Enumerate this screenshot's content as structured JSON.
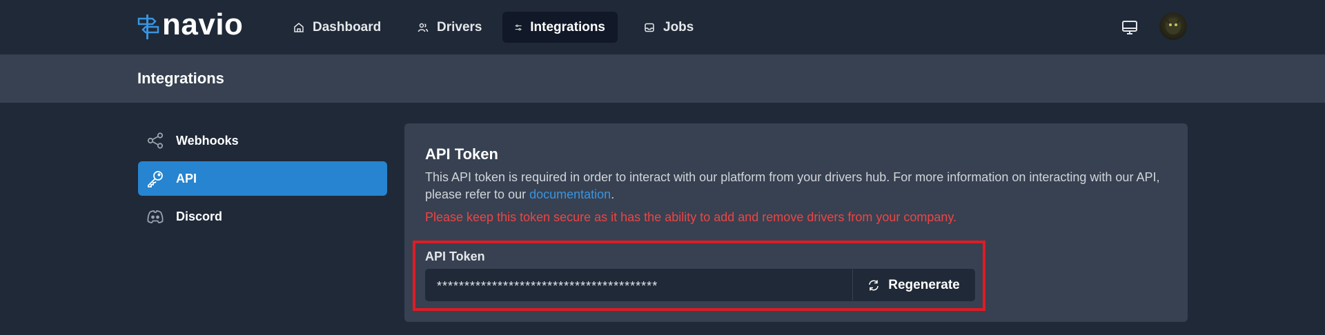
{
  "brand": {
    "name": "navio"
  },
  "nav": {
    "items": [
      {
        "label": "Dashboard",
        "icon": "home-icon"
      },
      {
        "label": "Drivers",
        "icon": "users-icon"
      },
      {
        "label": "Integrations",
        "icon": "sliders-icon",
        "active": true
      },
      {
        "label": "Jobs",
        "icon": "inbox-icon"
      }
    ]
  },
  "header": {
    "title": "Integrations"
  },
  "sidebar": {
    "items": [
      {
        "label": "Webhooks",
        "icon": "share-icon"
      },
      {
        "label": "API",
        "icon": "key-icon",
        "active": true
      },
      {
        "label": "Discord",
        "icon": "discord-icon"
      }
    ]
  },
  "card": {
    "title": "API Token",
    "desc_part1": "This API token is required in order to interact with our platform from your drivers hub. For more information on interacting with our API, please refer to our ",
    "desc_link": "documentation",
    "desc_part2": ".",
    "warning": "Please keep this token secure as it has the ability to add and remove drivers from your company.",
    "token_label": "API Token",
    "token_value": "****************************************",
    "regenerate_label": "Regenerate"
  },
  "colors": {
    "accent": "#2684d0",
    "background": "#1f2937",
    "card": "#374151",
    "warning": "#ef4444",
    "highlight": "#e01b24"
  }
}
